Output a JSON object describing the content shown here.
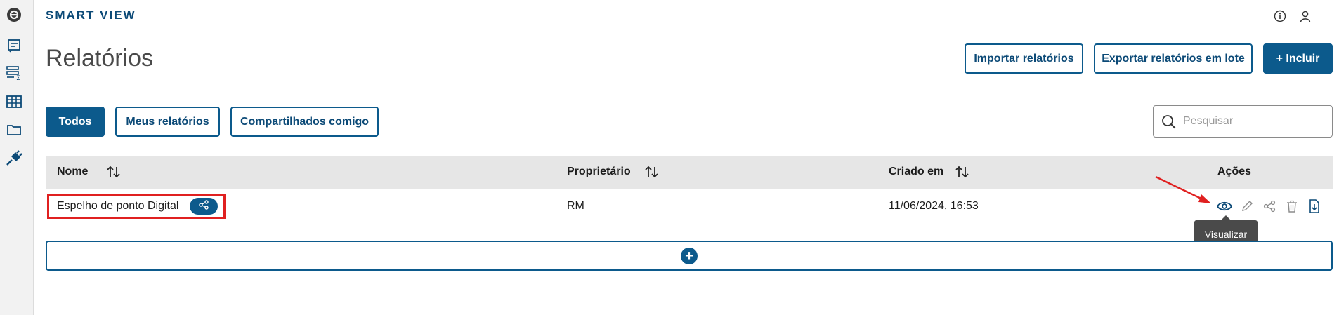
{
  "app": {
    "title": "SMART VIEW"
  },
  "page": {
    "title": "Relatórios"
  },
  "header_buttons": {
    "import": "Importar relatórios",
    "export": "Exportar relatórios em lote",
    "include": "+ Incluir"
  },
  "filters": [
    "Todos",
    "Meus relatórios",
    "Compartilhados comigo"
  ],
  "search": {
    "placeholder": "Pesquisar"
  },
  "table": {
    "columns": [
      "Nome",
      "Proprietário",
      "Criado em",
      "Ações"
    ],
    "rows": [
      {
        "name": "Espelho de ponto Digital",
        "owner": "RM",
        "created": "11/06/2024, 16:53"
      }
    ]
  },
  "tooltip": "Visualizar",
  "colors": {
    "primary": "#0c5a8c",
    "brand": "#0c4a77",
    "highlight": "#e02020"
  },
  "icons": [
    "logo-icon",
    "report-icon",
    "dataset-icon",
    "table-icon",
    "folder-icon",
    "plug-icon",
    "info-icon",
    "user-icon",
    "search-icon",
    "sort-icon",
    "share-icon",
    "eye-icon",
    "edit-icon",
    "trash-icon",
    "download-icon",
    "plus-icon"
  ]
}
